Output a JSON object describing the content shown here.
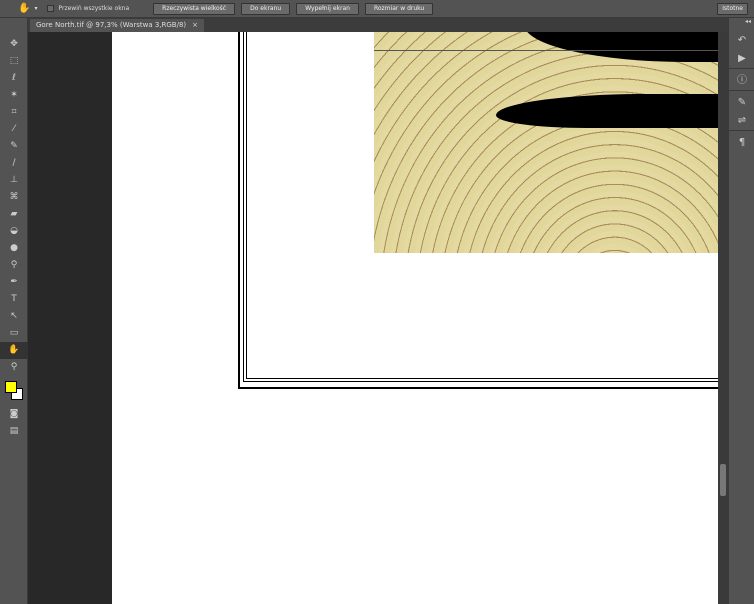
{
  "options_bar": {
    "tool_icon": "hand-icon",
    "checkbox_label": "Przewiń wszystkie okna",
    "buttons": [
      "Rzeczywista wielkość",
      "Do ekranu",
      "Wypełnij ekran",
      "Rozmiar w druku"
    ],
    "workspace": "Istotne"
  },
  "document_tab": {
    "title": "Gore North.tif @ 97,3% (Warstwa 3,RGB/8)",
    "close": "×"
  },
  "colors": {
    "foreground": "#ffff00",
    "background": "#ffffff"
  }
}
